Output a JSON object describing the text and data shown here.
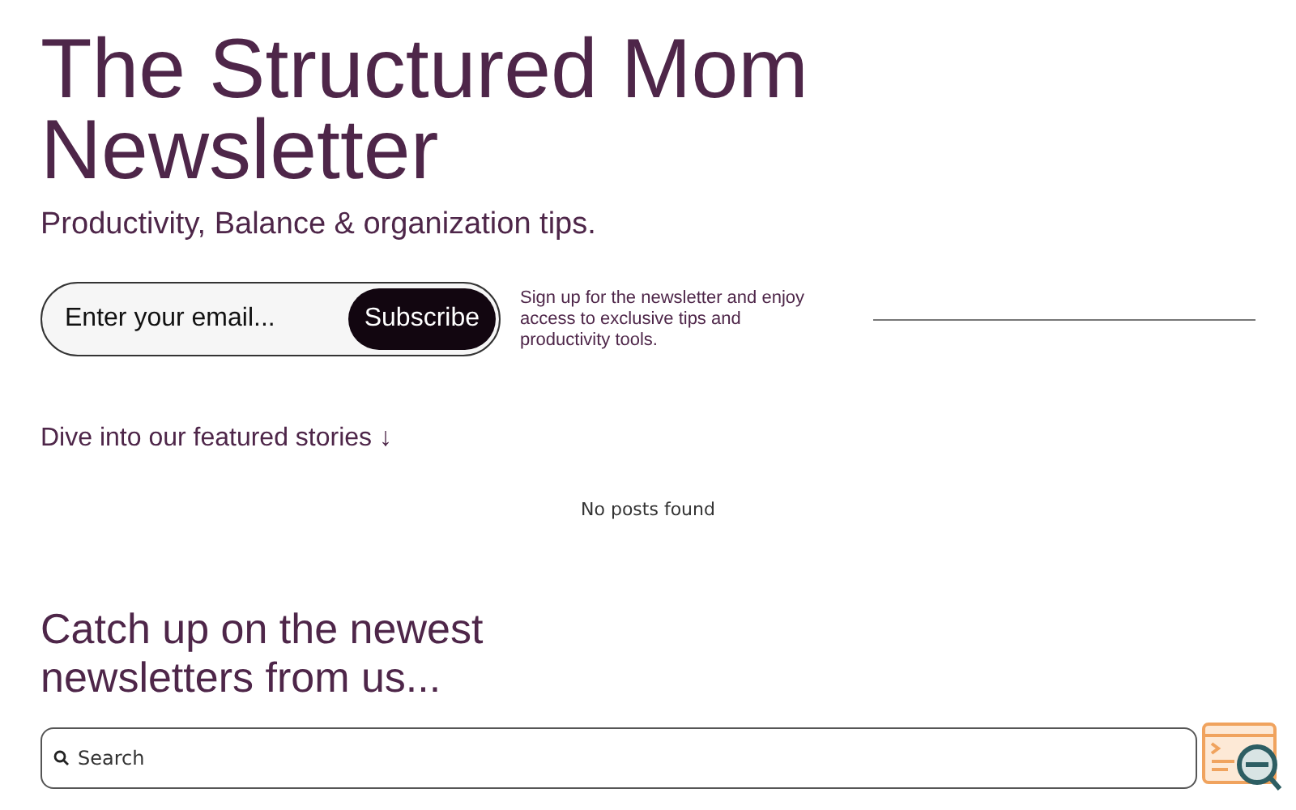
{
  "header": {
    "title": "The Structured Mom Newsletter",
    "tagline": "Productivity, Balance & organization tips."
  },
  "signup": {
    "placeholder": "Enter your email...",
    "button": "Subscribe",
    "note": "Sign up for the newsletter and enjoy access to exclusive tips and productivity tools."
  },
  "featured": {
    "heading": "Dive into our featured stories ↓",
    "empty": "No posts found"
  },
  "latest": {
    "heading": "Catch up on the newest newsletters from us...",
    "search_placeholder": "Search"
  }
}
